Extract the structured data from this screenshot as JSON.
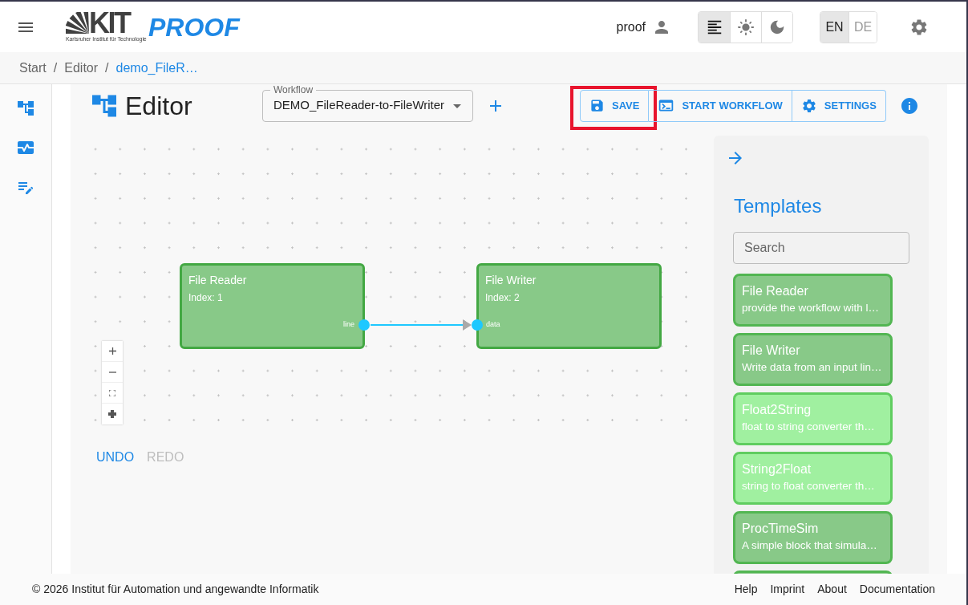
{
  "header": {
    "logo": {
      "wordmark": "KIT",
      "tagline": "Karlsruher Institut für Technologie"
    },
    "app_name": "PROOF",
    "user": {
      "name": "proof"
    },
    "theme_options": [
      {
        "kind": "auto",
        "selected": true
      },
      {
        "kind": "light",
        "selected": false
      },
      {
        "kind": "dark",
        "selected": false
      }
    ],
    "languages": [
      {
        "label": "EN",
        "selected": true
      },
      {
        "label": "DE",
        "selected": false
      }
    ]
  },
  "breadcrumbs": [
    {
      "label": "Start",
      "separator": "/",
      "current": false
    },
    {
      "label": "Editor",
      "separator": "/",
      "current": false
    },
    {
      "label": "demo_FileR…",
      "current": true
    }
  ],
  "page_title": "Editor",
  "toolbar": {
    "workflow_select": {
      "label": "Workflow",
      "value": "DEMO_FileReader-to-FileWriter"
    },
    "actions": [
      {
        "kind": "save",
        "label": "SAVE",
        "highlighted": true
      },
      {
        "kind": "start",
        "label": "START WORKFLOW",
        "highlighted": false
      },
      {
        "kind": "settings",
        "label": "SETTINGS",
        "highlighted": false
      }
    ]
  },
  "canvas": {
    "nodes": [
      {
        "title": "File Reader",
        "index": "Index: 1",
        "outputs": [
          {
            "label": "line",
            "connected": true
          }
        ]
      },
      {
        "title": "File Writer",
        "index": "Index: 2",
        "inputs": [
          {
            "label": "data"
          }
        ]
      }
    ]
  },
  "history": [
    {
      "label": "UNDO",
      "disabled": false
    },
    {
      "label": "REDO",
      "disabled": true
    }
  ],
  "templates": {
    "title": "Templates",
    "search": {
      "placeholder": "Search"
    },
    "items": [
      {
        "title": "File Reader",
        "description": "provide the workflow with l…",
        "color": "#88c988"
      },
      {
        "title": "File Writer",
        "description": "Write data from an input lin…",
        "color": "#88c988"
      },
      {
        "title": "Float2String",
        "description": "float to string converter th…",
        "color": "#a0f0a0"
      },
      {
        "title": "String2Float",
        "description": "string to float converter th…",
        "color": "#a0f0a0"
      },
      {
        "title": "ProcTimeSim",
        "description": "A simple block that simula…",
        "color": "#88c988"
      },
      {
        "color": "#88c988"
      }
    ]
  },
  "footer": {
    "copyright": "© 2026 Institut für Automation und angewandte Informatik",
    "links": [
      "Help",
      "Imprint",
      "About",
      "Documentation"
    ]
  }
}
